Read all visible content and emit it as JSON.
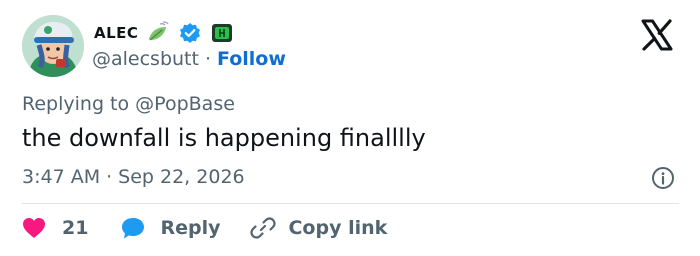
{
  "tweet": {
    "author": {
      "display_name": "ALEC",
      "handle": "@alecsbutt",
      "follow_label": "Follow",
      "separator": "·"
    },
    "reply_to_prefix": "Replying to",
    "reply_to_handle": "@PopBase",
    "text": "the downfall is happening finalllly",
    "time": "3:47 AM",
    "date": "Sep 22, 2026"
  },
  "actions": {
    "like_count": "21",
    "reply_label": "Reply",
    "copy_link_label": "Copy link"
  },
  "icons": {
    "logo": "x-logo-icon",
    "verified": "verified-badge-icon",
    "info": "info-icon",
    "like": "heart-icon",
    "reply": "reply-bubble-icon",
    "copy": "link-icon"
  },
  "colors": {
    "text_primary": "#0f1419",
    "text_secondary": "#536471",
    "accent": "#0f6fd1",
    "like": "#f91880",
    "reply": "#1d9bf0",
    "divider": "#dfe4e8"
  }
}
